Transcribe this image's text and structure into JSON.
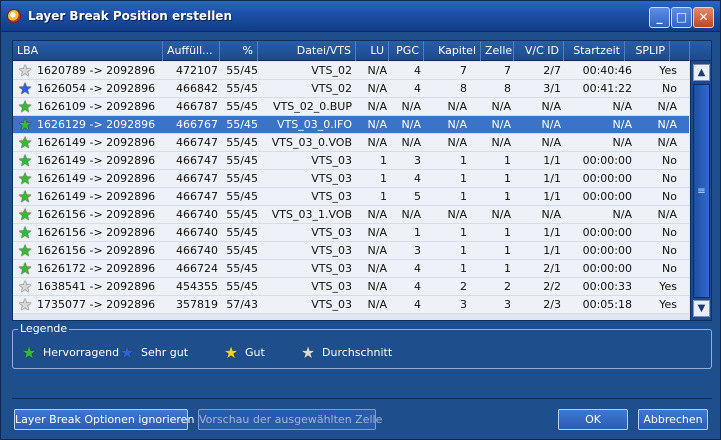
{
  "window": {
    "title": "Layer Break Position erstellen",
    "controls": [
      "minimize",
      "maximize",
      "close"
    ]
  },
  "table": {
    "columns": [
      "LBA",
      "Auffüll...",
      "%",
      "Datei/VTS",
      "LU",
      "PGC",
      "Kapitel",
      "Zelle",
      "V/C ID",
      "Startzeit",
      "SPLIP"
    ],
    "rows": [
      {
        "star": "white",
        "lba": "1620789 -> 2092896",
        "fill": "472107",
        "pct": "55/45",
        "file": "VTS_02",
        "lu": "N/A",
        "pgc": "4",
        "chapter": "7",
        "cell": "7",
        "vcid": "2/7",
        "start": "00:40:46",
        "splip": "Yes"
      },
      {
        "star": "blue",
        "lba": "1626054 -> 2092896",
        "fill": "466842",
        "pct": "55/45",
        "file": "VTS_02",
        "lu": "N/A",
        "pgc": "4",
        "chapter": "8",
        "cell": "8",
        "vcid": "3/1",
        "start": "00:41:22",
        "splip": "No"
      },
      {
        "star": "green",
        "lba": "1626109 -> 2092896",
        "fill": "466787",
        "pct": "55/45",
        "file": "VTS_02_0.BUP",
        "lu": "N/A",
        "pgc": "N/A",
        "chapter": "N/A",
        "cell": "N/A",
        "vcid": "N/A",
        "start": "N/A",
        "splip": "N/A"
      },
      {
        "star": "green",
        "lba": "1626129 -> 2092896",
        "fill": "466767",
        "pct": "55/45",
        "file": "VTS_03_0.IFO",
        "lu": "N/A",
        "pgc": "N/A",
        "chapter": "N/A",
        "cell": "N/A",
        "vcid": "N/A",
        "start": "N/A",
        "splip": "N/A",
        "selected": true
      },
      {
        "star": "green",
        "lba": "1626149 -> 2092896",
        "fill": "466747",
        "pct": "55/45",
        "file": "VTS_03_0.VOB",
        "lu": "N/A",
        "pgc": "N/A",
        "chapter": "N/A",
        "cell": "N/A",
        "vcid": "N/A",
        "start": "N/A",
        "splip": "N/A"
      },
      {
        "star": "green",
        "lba": "1626149 -> 2092896",
        "fill": "466747",
        "pct": "55/45",
        "file": "VTS_03",
        "lu": "1",
        "pgc": "3",
        "chapter": "1",
        "cell": "1",
        "vcid": "1/1",
        "start": "00:00:00",
        "splip": "No"
      },
      {
        "star": "green",
        "lba": "1626149 -> 2092896",
        "fill": "466747",
        "pct": "55/45",
        "file": "VTS_03",
        "lu": "1",
        "pgc": "4",
        "chapter": "1",
        "cell": "1",
        "vcid": "1/1",
        "start": "00:00:00",
        "splip": "No"
      },
      {
        "star": "green",
        "lba": "1626149 -> 2092896",
        "fill": "466747",
        "pct": "55/45",
        "file": "VTS_03",
        "lu": "1",
        "pgc": "5",
        "chapter": "1",
        "cell": "1",
        "vcid": "1/1",
        "start": "00:00:00",
        "splip": "No"
      },
      {
        "star": "green",
        "lba": "1626156 -> 2092896",
        "fill": "466740",
        "pct": "55/45",
        "file": "VTS_03_1.VOB",
        "lu": "N/A",
        "pgc": "N/A",
        "chapter": "N/A",
        "cell": "N/A",
        "vcid": "N/A",
        "start": "N/A",
        "splip": "N/A"
      },
      {
        "star": "green",
        "lba": "1626156 -> 2092896",
        "fill": "466740",
        "pct": "55/45",
        "file": "VTS_03",
        "lu": "N/A",
        "pgc": "1",
        "chapter": "1",
        "cell": "1",
        "vcid": "1/1",
        "start": "00:00:00",
        "splip": "No"
      },
      {
        "star": "green",
        "lba": "1626156 -> 2092896",
        "fill": "466740",
        "pct": "55/45",
        "file": "VTS_03",
        "lu": "N/A",
        "pgc": "3",
        "chapter": "1",
        "cell": "1",
        "vcid": "1/1",
        "start": "00:00:00",
        "splip": "No"
      },
      {
        "star": "green",
        "lba": "1626172 -> 2092896",
        "fill": "466724",
        "pct": "55/45",
        "file": "VTS_03",
        "lu": "N/A",
        "pgc": "4",
        "chapter": "1",
        "cell": "1",
        "vcid": "2/1",
        "start": "00:00:00",
        "splip": "No"
      },
      {
        "star": "white",
        "lba": "1638541 -> 2092896",
        "fill": "454355",
        "pct": "55/45",
        "file": "VTS_03",
        "lu": "N/A",
        "pgc": "4",
        "chapter": "2",
        "cell": "2",
        "vcid": "2/2",
        "start": "00:00:33",
        "splip": "Yes"
      },
      {
        "star": "white",
        "lba": "1735077 -> 2092896",
        "fill": "357819",
        "pct": "57/43",
        "file": "VTS_03",
        "lu": "N/A",
        "pgc": "4",
        "chapter": "3",
        "cell": "3",
        "vcid": "2/3",
        "start": "00:05:18",
        "splip": "Yes"
      }
    ]
  },
  "legend": {
    "title": "Legende",
    "items": [
      {
        "label": "Hervorragend",
        "star": "green"
      },
      {
        "label": "Sehr gut",
        "star": "blue"
      },
      {
        "label": "Gut",
        "star": "yellow"
      },
      {
        "label": "Durchschnitt",
        "star": "white"
      }
    ]
  },
  "buttons": {
    "ignore": "Layer Break Optionen ignorieren",
    "preview": "Vorschau der ausgewählten Zelle",
    "ok": "OK",
    "cancel": "Abbrechen"
  },
  "colors": {
    "green": "#2fbf2f",
    "blue": "#2d5fe0",
    "yellow": "#f2d21b",
    "white": "#d9d9d9",
    "selected_row": "#3a73c8"
  }
}
